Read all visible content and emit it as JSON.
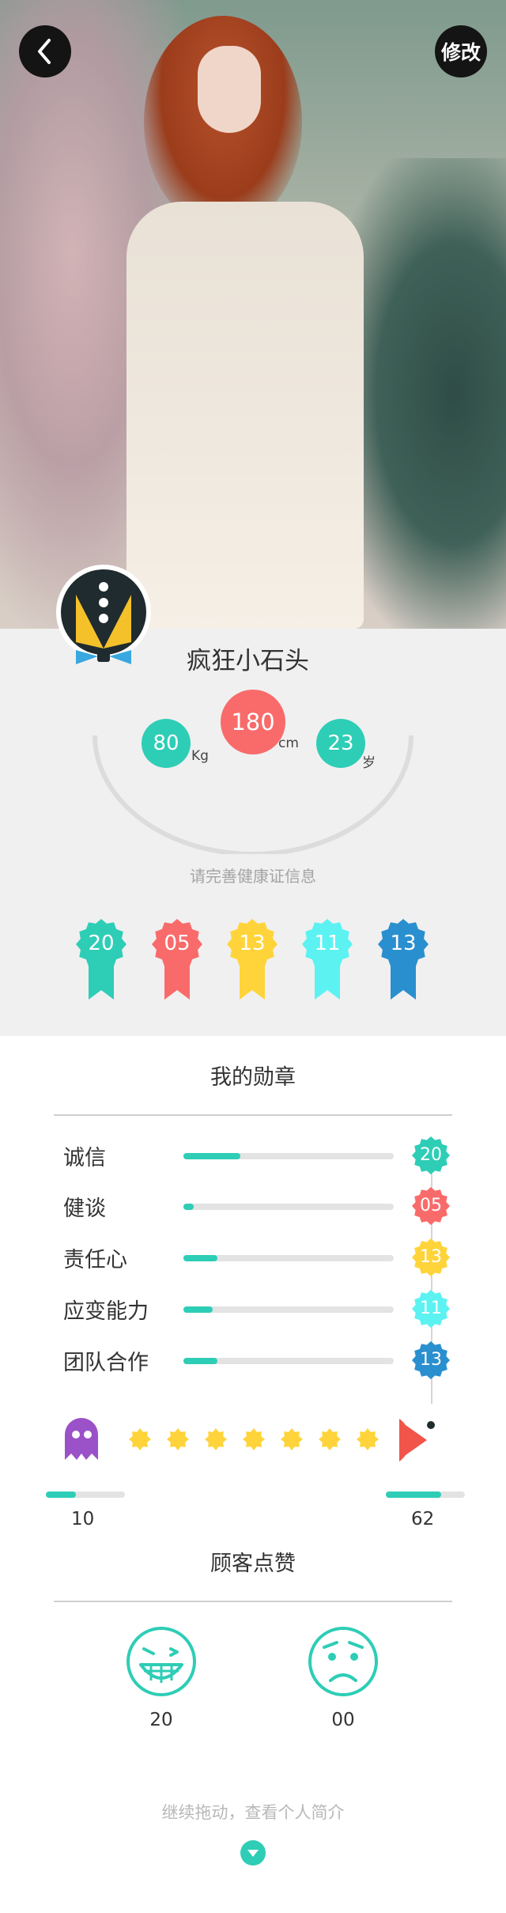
{
  "header": {
    "back_icon": "chevron-left-icon",
    "edit_label": "修改"
  },
  "profile": {
    "nickname": "疯狂小石头",
    "avatar_icon": "tuxedo-avatar-icon",
    "weight": {
      "value": "80",
      "unit": "Kg"
    },
    "height": {
      "value": "180",
      "unit": "cm"
    },
    "age": {
      "value": "23",
      "unit": "岁"
    },
    "health_tip": "请完善健康证信息",
    "ribbons": [
      {
        "value": "20",
        "color": "#2ecdb6"
      },
      {
        "value": "05",
        "color": "#f96b6b"
      },
      {
        "value": "13",
        "color": "#ffd43b"
      },
      {
        "value": "11",
        "color": "#5cf2f2"
      },
      {
        "value": "13",
        "color": "#2a8fcf"
      }
    ]
  },
  "medals": {
    "title": "我的勋章",
    "items": [
      {
        "label": "诚信",
        "value": "20",
        "progress": 0.27,
        "color": "#2ecdb6"
      },
      {
        "label": "健谈",
        "value": "05",
        "progress": 0.05,
        "color": "#f96b6b"
      },
      {
        "label": "责任心",
        "value": "13",
        "progress": 0.16,
        "color": "#ffd43b"
      },
      {
        "label": "应变能力",
        "value": "11",
        "progress": 0.14,
        "color": "#5cf2f2"
      },
      {
        "label": "团队合作",
        "value": "13",
        "progress": 0.16,
        "color": "#2a8fcf"
      }
    ]
  },
  "game": {
    "left_score": "10",
    "right_score": "62",
    "left_progress": 0.38,
    "right_progress": 0.7,
    "ghost_icon": "ghost-icon",
    "pacman_icon": "pacman-icon",
    "dot_icon": "star-dot-icon"
  },
  "praise": {
    "title": "顾客点赞",
    "like_count": "20",
    "dislike_count": "00"
  },
  "footer": {
    "drag_hint": "继续拖动，查看个人简介",
    "down_icon": "chevron-down-icon"
  }
}
